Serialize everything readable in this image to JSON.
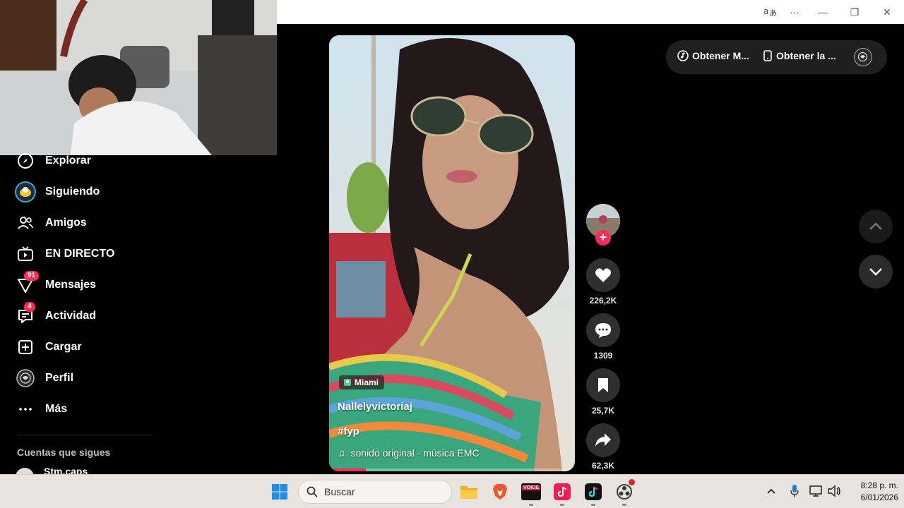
{
  "browser": {
    "translate_icon": "translate-icon",
    "more_label": "···",
    "minimize_label": "—",
    "restore_label": "❐",
    "close_label": "✕"
  },
  "sidebar": {
    "items": [
      {
        "label": "Explorar",
        "icon": "compass-icon"
      },
      {
        "label": "Siguiendo",
        "icon": "following-avatar-icon"
      },
      {
        "label": "Amigos",
        "icon": "friends-icon"
      },
      {
        "label": "EN DIRECTO",
        "icon": "live-tv-icon"
      },
      {
        "label": "Mensajes",
        "icon": "messages-icon",
        "badge": "91"
      },
      {
        "label": "Actividad",
        "icon": "activity-icon",
        "badge": "4"
      },
      {
        "label": "Cargar",
        "icon": "upload-icon"
      },
      {
        "label": "Perfil",
        "icon": "profile-icon"
      },
      {
        "label": "Más",
        "icon": "more-icon"
      }
    ],
    "following_heading": "Cuentas que sigues",
    "following_first": "Stm.caps"
  },
  "video": {
    "location": "Miami",
    "author": "Nallelyvictoriaj",
    "hashtag": "#fyp",
    "sound": "sonido original - música EMC",
    "progress_fraction": 0.15
  },
  "actions": {
    "likes": "226,2K",
    "comments": "1309",
    "saves": "25,7K",
    "shares": "62,3K"
  },
  "top_pill": {
    "get_music": "Obtener M...",
    "get_app": "Obtener la ..."
  },
  "taskbar": {
    "search_placeholder": "Buscar",
    "time": "8:28 p. m.",
    "date": "6/01/2026",
    "voicemod_label": "VOICE"
  },
  "colors": {
    "accent": "#fe2c55",
    "sidebar_bg": "#000000",
    "taskbar_bg": "#e9e3dd"
  }
}
